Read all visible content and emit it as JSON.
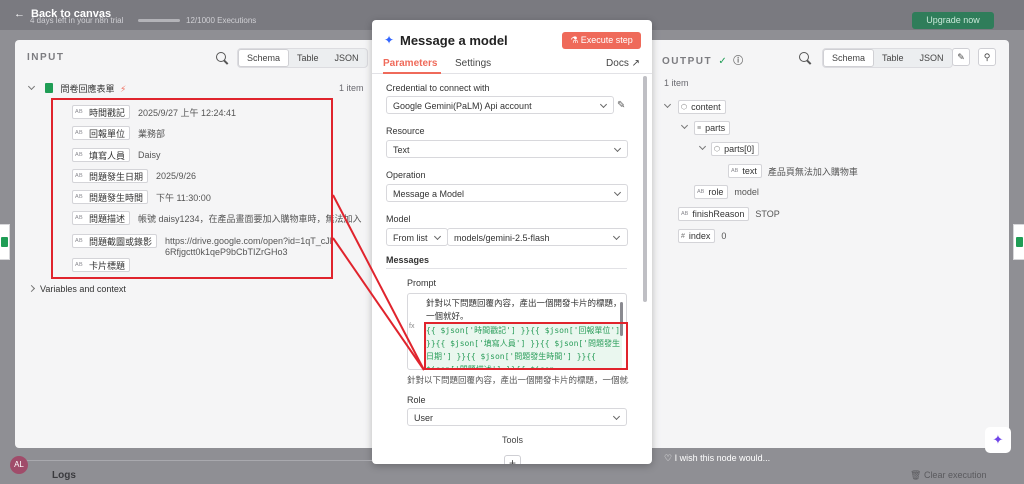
{
  "topbar": {
    "back_label": "Back to canvas",
    "trial_text": "4 days left in your n8n trial",
    "executions_text": "12/1000 Executions",
    "upgrade_label": "Upgrade now"
  },
  "input": {
    "title": "INPUT",
    "view_tabs": [
      "Schema",
      "Table",
      "JSON"
    ],
    "active_view": "Schema",
    "node_name": "問卷回應表單",
    "item_count": "1 item",
    "fields": [
      {
        "key": "時間戳記",
        "value": "2025/9/27 上午 12:24:41"
      },
      {
        "key": "回報單位",
        "value": "業務部"
      },
      {
        "key": "填寫人員",
        "value": "Daisy"
      },
      {
        "key": "問題發生日期",
        "value": "2025/9/26"
      },
      {
        "key": "問題發生時間",
        "value": "下午 11:30:00"
      },
      {
        "key": "問題描述",
        "value": "帳號 daisy1234，在產品畫面要加入購物車時，無法加入"
      },
      {
        "key": "問題截圖或錄影",
        "value": "https://drive.google.com/open?id=1qT_cJl6Rfjgctt0k1qeP9bCbTIZrGHo3"
      },
      {
        "key": "卡片標題",
        "value": ""
      }
    ],
    "variables_label": "Variables and context"
  },
  "modal": {
    "title": "Message a model",
    "execute_label": "Execute step",
    "tabs": {
      "parameters": "Parameters",
      "settings": "Settings",
      "docs": "Docs"
    },
    "credential_label": "Credential to connect with",
    "credential_value": "Google Gemini(PaLM) Api account",
    "resource_label": "Resource",
    "resource_value": "Text",
    "operation_label": "Operation",
    "operation_value": "Message a Model",
    "model_label": "Model",
    "model_mode": "From list",
    "model_value": "models/gemini-2.5-flash",
    "messages_label": "Messages",
    "prompt_label": "Prompt",
    "prompt_text": "針對以下問題回覆內容，產出一個開發卡片的標題，一個就好。",
    "prompt_code": "{{ $json['時間戳記'] }}{{ $json['回報單位'] }}{{ $json['填寫人員'] }}{{ $json['問題發生日期'] }}{{ $json['問題發生時間'] }}{{ $json['問題描述'] }}{{ $json",
    "prompt_preview": "針對以下問題回覆內容，產出一個開發卡片的標題，一個就...",
    "fx_label": "fx",
    "role_label": "Role",
    "role_value": "User",
    "tools_label": "Tools",
    "add_label": "+"
  },
  "output": {
    "title": "OUTPUT",
    "view_tabs": [
      "Schema",
      "Table",
      "JSON"
    ],
    "active_view": "Schema",
    "item_count": "1 item",
    "tree": [
      {
        "key": "content",
        "type": "object",
        "value": ""
      },
      {
        "key": "parts",
        "type": "array",
        "value": ""
      },
      {
        "key": "parts[0]",
        "type": "object",
        "value": ""
      },
      {
        "key": "text",
        "type": "string",
        "value": "產品頁無法加入購物車"
      },
      {
        "key": "role",
        "type": "string",
        "value": "model"
      },
      {
        "key": "finishReason",
        "type": "string",
        "value": "STOP"
      },
      {
        "key": "index",
        "type": "number",
        "value": "0"
      }
    ]
  },
  "footer": {
    "wish_text": "I wish this node would...",
    "logs_label": "Logs",
    "clear_label": "Clear execution",
    "avatar_initials": "AL"
  },
  "colors": {
    "accent": "#ef6a5a",
    "highlight": "#e0242d",
    "success": "#1f9d55"
  }
}
